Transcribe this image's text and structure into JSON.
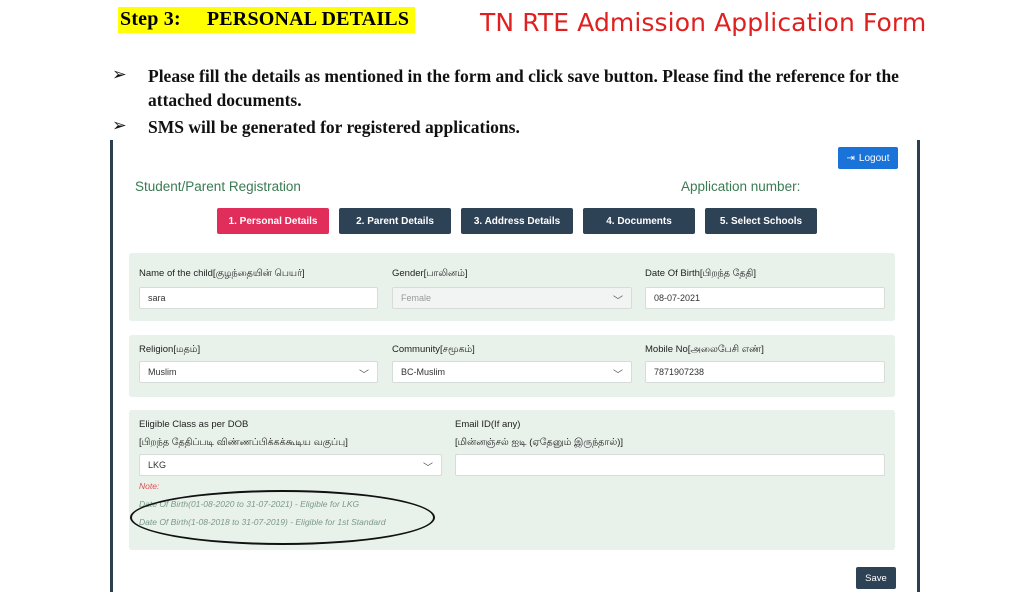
{
  "header": {
    "step_label": "Step 3:",
    "step_title": "PERSONAL DETAILS",
    "form_title": "TN RTE Admission Application Form"
  },
  "bullets": [
    {
      "arrow": "➢",
      "text": "Please fill the details as mentioned in the form and click save button. Please find the reference for the attached documents."
    },
    {
      "arrow": "➢",
      "text": "SMS will be generated for registered applications."
    }
  ],
  "app": {
    "logout_label": "Logout",
    "logout_icon": "logout-icon",
    "registration_title": "Student/Parent Registration",
    "application_number_label": "Application number:",
    "tabs": [
      {
        "label": "1. Personal Details",
        "active": true
      },
      {
        "label": "2. Parent Details",
        "active": false
      },
      {
        "label": "3. Address Details",
        "active": false
      },
      {
        "label": "4. Documents",
        "active": false
      },
      {
        "label": "5. Select Schools",
        "active": false
      }
    ],
    "fields": {
      "child_name": {
        "label": "Name of the child[குழந்தையின் பெயர்]",
        "value": "sara"
      },
      "gender": {
        "label": "Gender[பாலினம்]",
        "value": "Female"
      },
      "dob": {
        "label": "Date Of Birth[பிறந்த தேதி]",
        "value": "08-07-2021"
      },
      "religion": {
        "label": "Religion[மதம்]",
        "value": "Muslim"
      },
      "community": {
        "label": "Community[சமூகம்]",
        "value": "BC-Muslim"
      },
      "mobile": {
        "label": "Mobile No[அலைபேசி எண்]",
        "value": "7871907238"
      },
      "eligible_class": {
        "label": "Eligible Class as per DOB",
        "label_tamil": "[பிறந்த தேதிப்படி விண்ணப்பிக்கக்கூடிய வகுப்பு]",
        "value": "LKG"
      },
      "email": {
        "label": "Email ID(If any)",
        "label_tamil": "[மின்னஞ்சல் ஐடி (ஏதேனும் இருந்தால்)]",
        "value": ""
      }
    },
    "note": {
      "label": "Note:",
      "lines": [
        "Date Of Birth(01-08-2020 to 31-07-2021) - Eligible for LKG",
        "Date Of Birth(1-08-2018 to 31-07-2019) - Eligible for 1st Standard"
      ]
    },
    "save_label": "Save"
  },
  "colors": {
    "highlight": "#ffff00",
    "title_red": "#e02020",
    "tab_active": "#e02d5a",
    "tab_inactive": "#2e4256",
    "logout_blue": "#1a73d9",
    "green_text": "#3a7a52",
    "panel_bg": "#e9f1eb"
  }
}
